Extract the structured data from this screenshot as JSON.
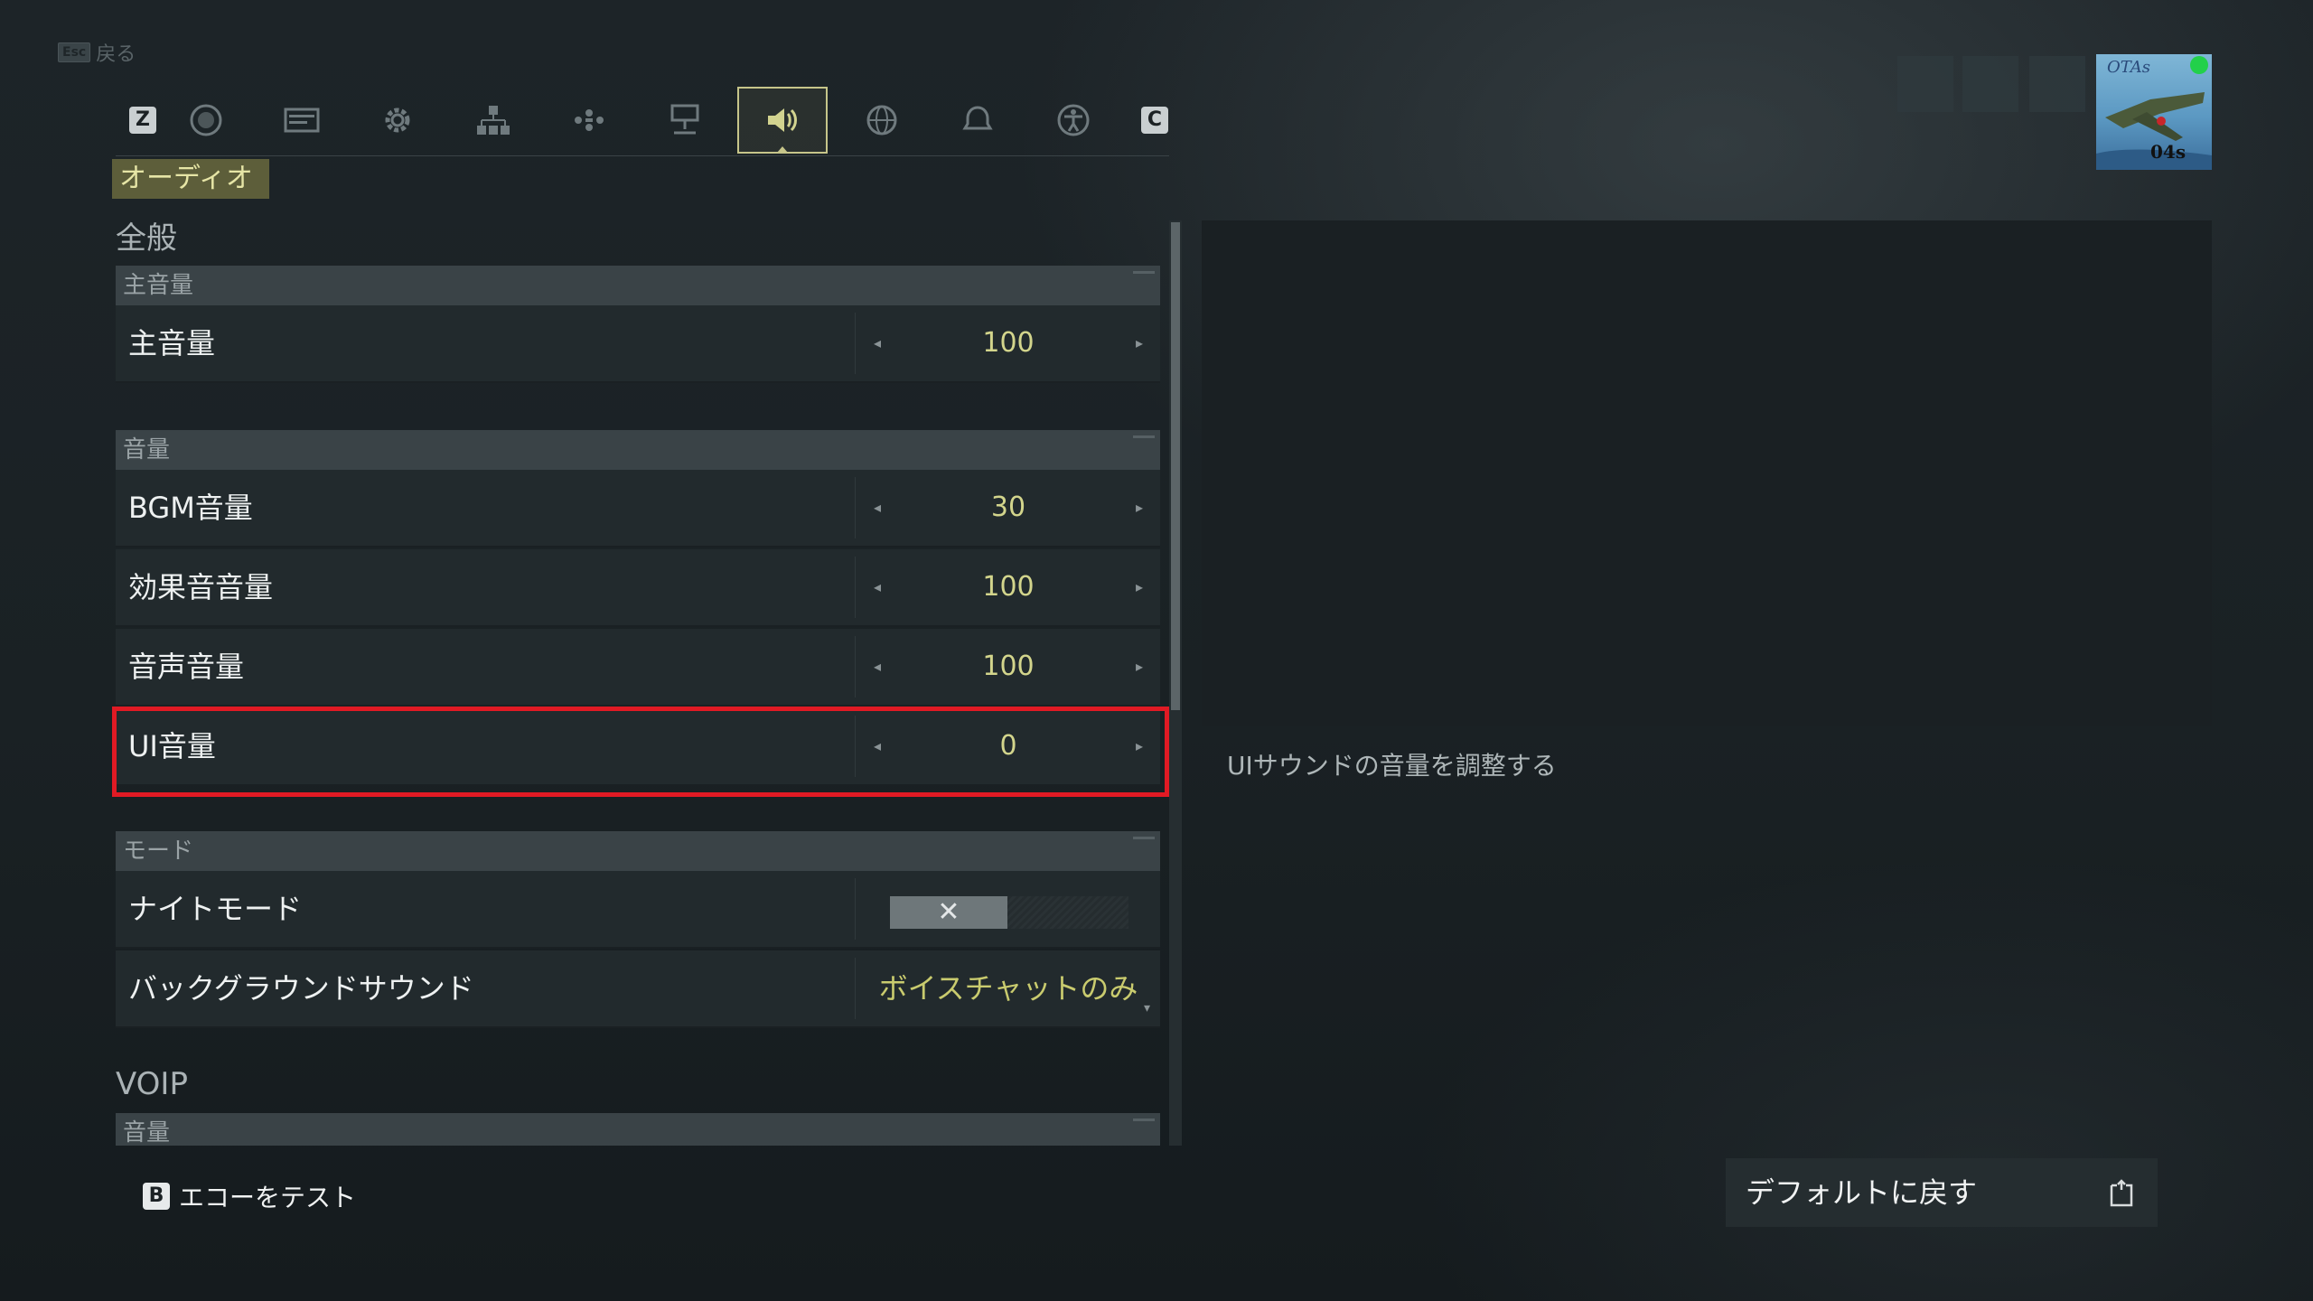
{
  "back": {
    "key": "Esc",
    "label": "戻る"
  },
  "tabbar": {
    "left_key": "Z",
    "right_key": "C",
    "tabs": [
      {
        "icon": "chat-bubble-icon"
      },
      {
        "icon": "display-icon"
      },
      {
        "icon": "gear-icon"
      },
      {
        "icon": "hierarchy-icon"
      },
      {
        "icon": "gamepad-icon"
      },
      {
        "icon": "network-icon"
      },
      {
        "icon": "speaker-icon",
        "active": true
      },
      {
        "icon": "globe-icon"
      },
      {
        "icon": "notification-icon"
      },
      {
        "icon": "accessibility-icon"
      }
    ]
  },
  "section_label": "オーディオ",
  "general": {
    "title": "全般",
    "master": {
      "header": "主音量",
      "row": {
        "label": "主音量",
        "value": "100"
      }
    },
    "volume": {
      "header": "音量",
      "rows": [
        {
          "label": "BGM音量",
          "value": "30"
        },
        {
          "label": "効果音音量",
          "value": "100"
        },
        {
          "label": "音声音量",
          "value": "100"
        },
        {
          "label": "UI音量",
          "value": "0"
        }
      ]
    },
    "mode": {
      "header": "モード",
      "night_mode": {
        "label": "ナイトモード",
        "state": "off"
      },
      "background_sound": {
        "label": "バックグラウンドサウンド",
        "value": "ボイスチャットのみ"
      }
    }
  },
  "voip": {
    "title": "VOIP",
    "header": "音量"
  },
  "info": {
    "description": "UIサウンドの音量を調整する"
  },
  "footer": {
    "echo_test": {
      "key": "B",
      "label": "エコーをテスト"
    },
    "reset": {
      "label": "デフォルトに戻す"
    }
  },
  "profile": {
    "avatar_text_top": "OTAs",
    "avatar_text_bottom": "04s",
    "status": "online"
  },
  "colors": {
    "accent": "#c6c58a",
    "value": "#d3d58c",
    "highlight": "#e11a24"
  }
}
